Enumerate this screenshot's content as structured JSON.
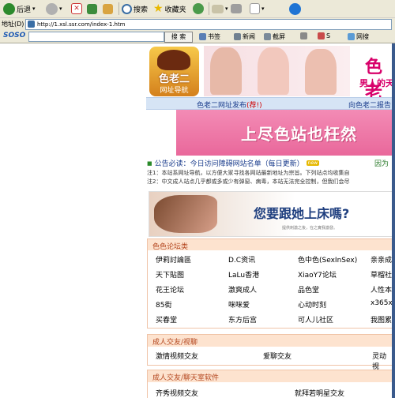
{
  "toolbar": {
    "back": "后退",
    "search": "搜索",
    "favorites": "收藏夹"
  },
  "address": {
    "label": "地址(D)",
    "url": "http://1.xsl.ssr.com/index-1.htm"
  },
  "soso": {
    "logo": "SOSO",
    "search_btn": "搜 索",
    "items": [
      "书签",
      "新闻",
      "截屏",
      "S",
      "网搜"
    ]
  },
  "header": {
    "logo_text": "色老二",
    "logo_sub": "网址导航",
    "right_title": "色老",
    "right_sub": "男人的天"
  },
  "notice_bar": {
    "left_prefix": "色老二网址发布",
    "left_hot": "(荐!)",
    "right": "向色老二报告"
  },
  "banner1": {
    "text": "上尽色站也枉然"
  },
  "announce": {
    "bullet": "■",
    "text": "公告必读：今日访问障碍网站名单（每日更新）",
    "new": "new",
    "right": "因为"
  },
  "notes": [
    "注1：本站系网址导航，以方便大家寻找各网站最新地址为宗旨。下列站点均收集自",
    "注2：中文成人站点几乎都或多或少有弹窗、病毒，本站无法完全控制，但我们会尽"
  ],
  "banner2": {
    "text": "您要跟她上床嗎?",
    "sub": "提供刺激之後，在之實我激發。"
  },
  "section1": {
    "title": "色色论坛类",
    "rows": [
      [
        "伊莉討論區",
        "D.C资讯",
        "色中色(SexInSex)",
        "亲亲成"
      ],
      [
        "天下貼图",
        "LaLu香港",
        "XiaoY7论坛",
        "草榴社"
      ],
      [
        "花王论坛",
        "激爽成人",
        "品色堂",
        "人性本"
      ],
      [
        "85街",
        "咪咪爱",
        "心动时刻",
        "x365x"
      ],
      [
        "买春堂",
        "东方后宫",
        "可人儿社区",
        "我图累"
      ]
    ]
  },
  "section2": {
    "title": "成人交友/视聊",
    "items": [
      "激情视频交友",
      "爱聊交友",
      "灵动视"
    ]
  },
  "section3": {
    "title": "成人交友/聊天室软件",
    "items": [
      "齐秀视频交友",
      "",
      "就拜若明星交友"
    ]
  },
  "colors": {
    "chrome": "#ece9d8",
    "section_header": "#fde3cf",
    "section_title": "#b3441c",
    "banner_pink": "#f07aa8",
    "notice_blue": "#d6e4f5",
    "hot_red": "#d00000"
  }
}
